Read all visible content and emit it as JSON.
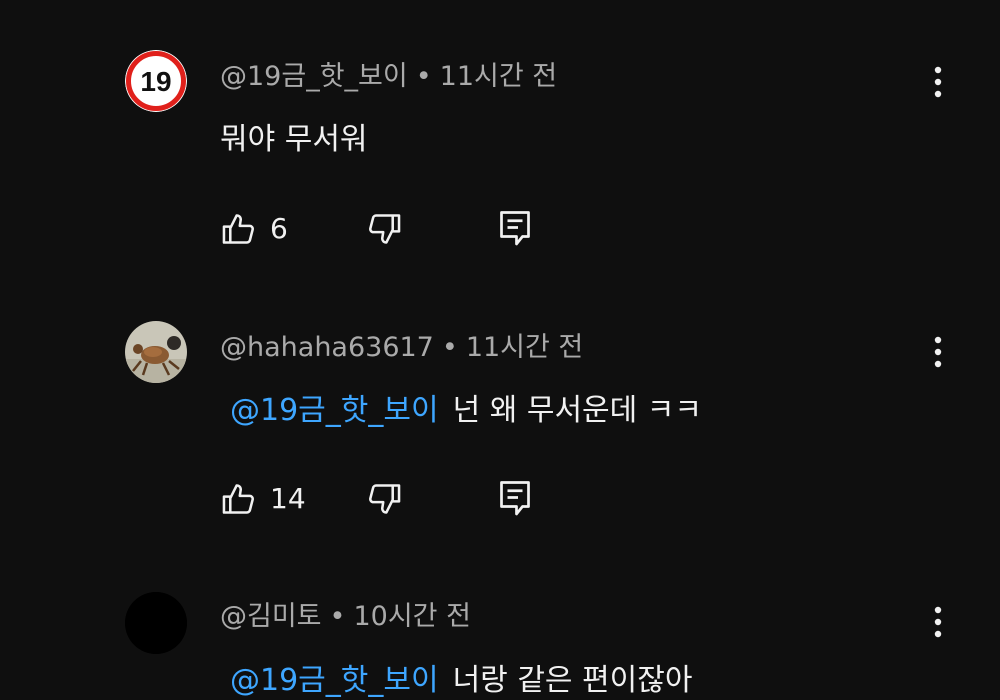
{
  "comments": [
    {
      "avatar_badge": "19",
      "handle": "@19금_핫_보이",
      "separator": "•",
      "time": "11시간 전",
      "mention": "",
      "text": "뭐야 무서워",
      "likes": "6",
      "icons": [
        "thumbs-up-icon",
        "thumbs-down-icon",
        "reply-icon",
        "kebab-menu-icon"
      ]
    },
    {
      "avatar_badge": "",
      "handle": "@hahaha63617",
      "separator": "•",
      "time": "11시간 전",
      "mention": "@19금_핫_보이",
      "text": "넌 왜 무서운데 ㅋㅋ",
      "likes": "14",
      "icons": [
        "thumbs-up-icon",
        "thumbs-down-icon",
        "reply-icon",
        "kebab-menu-icon"
      ]
    },
    {
      "avatar_badge": "",
      "handle": "@김미토",
      "separator": "•",
      "time": "10시간 전",
      "mention": "@19금_핫_보이",
      "text": "너랑 같은 편이잖아",
      "likes": "",
      "icons": [
        "kebab-menu-icon"
      ]
    }
  ],
  "colors": {
    "background": "#0f0f0f",
    "meta_text": "#aaaaaa",
    "body_text": "#f1f1f1",
    "mention": "#3ea6ff",
    "badge_red": "#e0201b"
  }
}
